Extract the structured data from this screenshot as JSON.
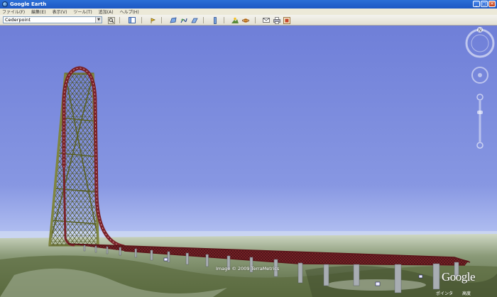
{
  "window": {
    "title": "Google Earth"
  },
  "menu": [
    "ファイル(F)",
    "編集(E)",
    "表示(V)",
    "ツール(T)",
    "追加(A)",
    "ヘルプ(H)"
  ],
  "toolbar": {
    "search_value": "Cederpoint",
    "icons": [
      "search-icon",
      "sidebar-icon",
      "placemark-icon",
      "polygon-icon",
      "path-icon",
      "overlay-icon",
      "ruler-icon",
      "sunlight-icon",
      "planet-icon",
      "email-icon",
      "print-icon",
      "image-icon"
    ]
  },
  "nav": {
    "compass_label": "N"
  },
  "footer": {
    "copyright": "Image © 2009 TerraMetrics",
    "logo": "Google",
    "status_left": "ポインタ",
    "status_right": "高度"
  },
  "colors": {
    "sky_top": "#6f7fd8",
    "sky_bottom": "#a9b6f0",
    "track": "#7a2228",
    "tower": "#6d7338"
  }
}
